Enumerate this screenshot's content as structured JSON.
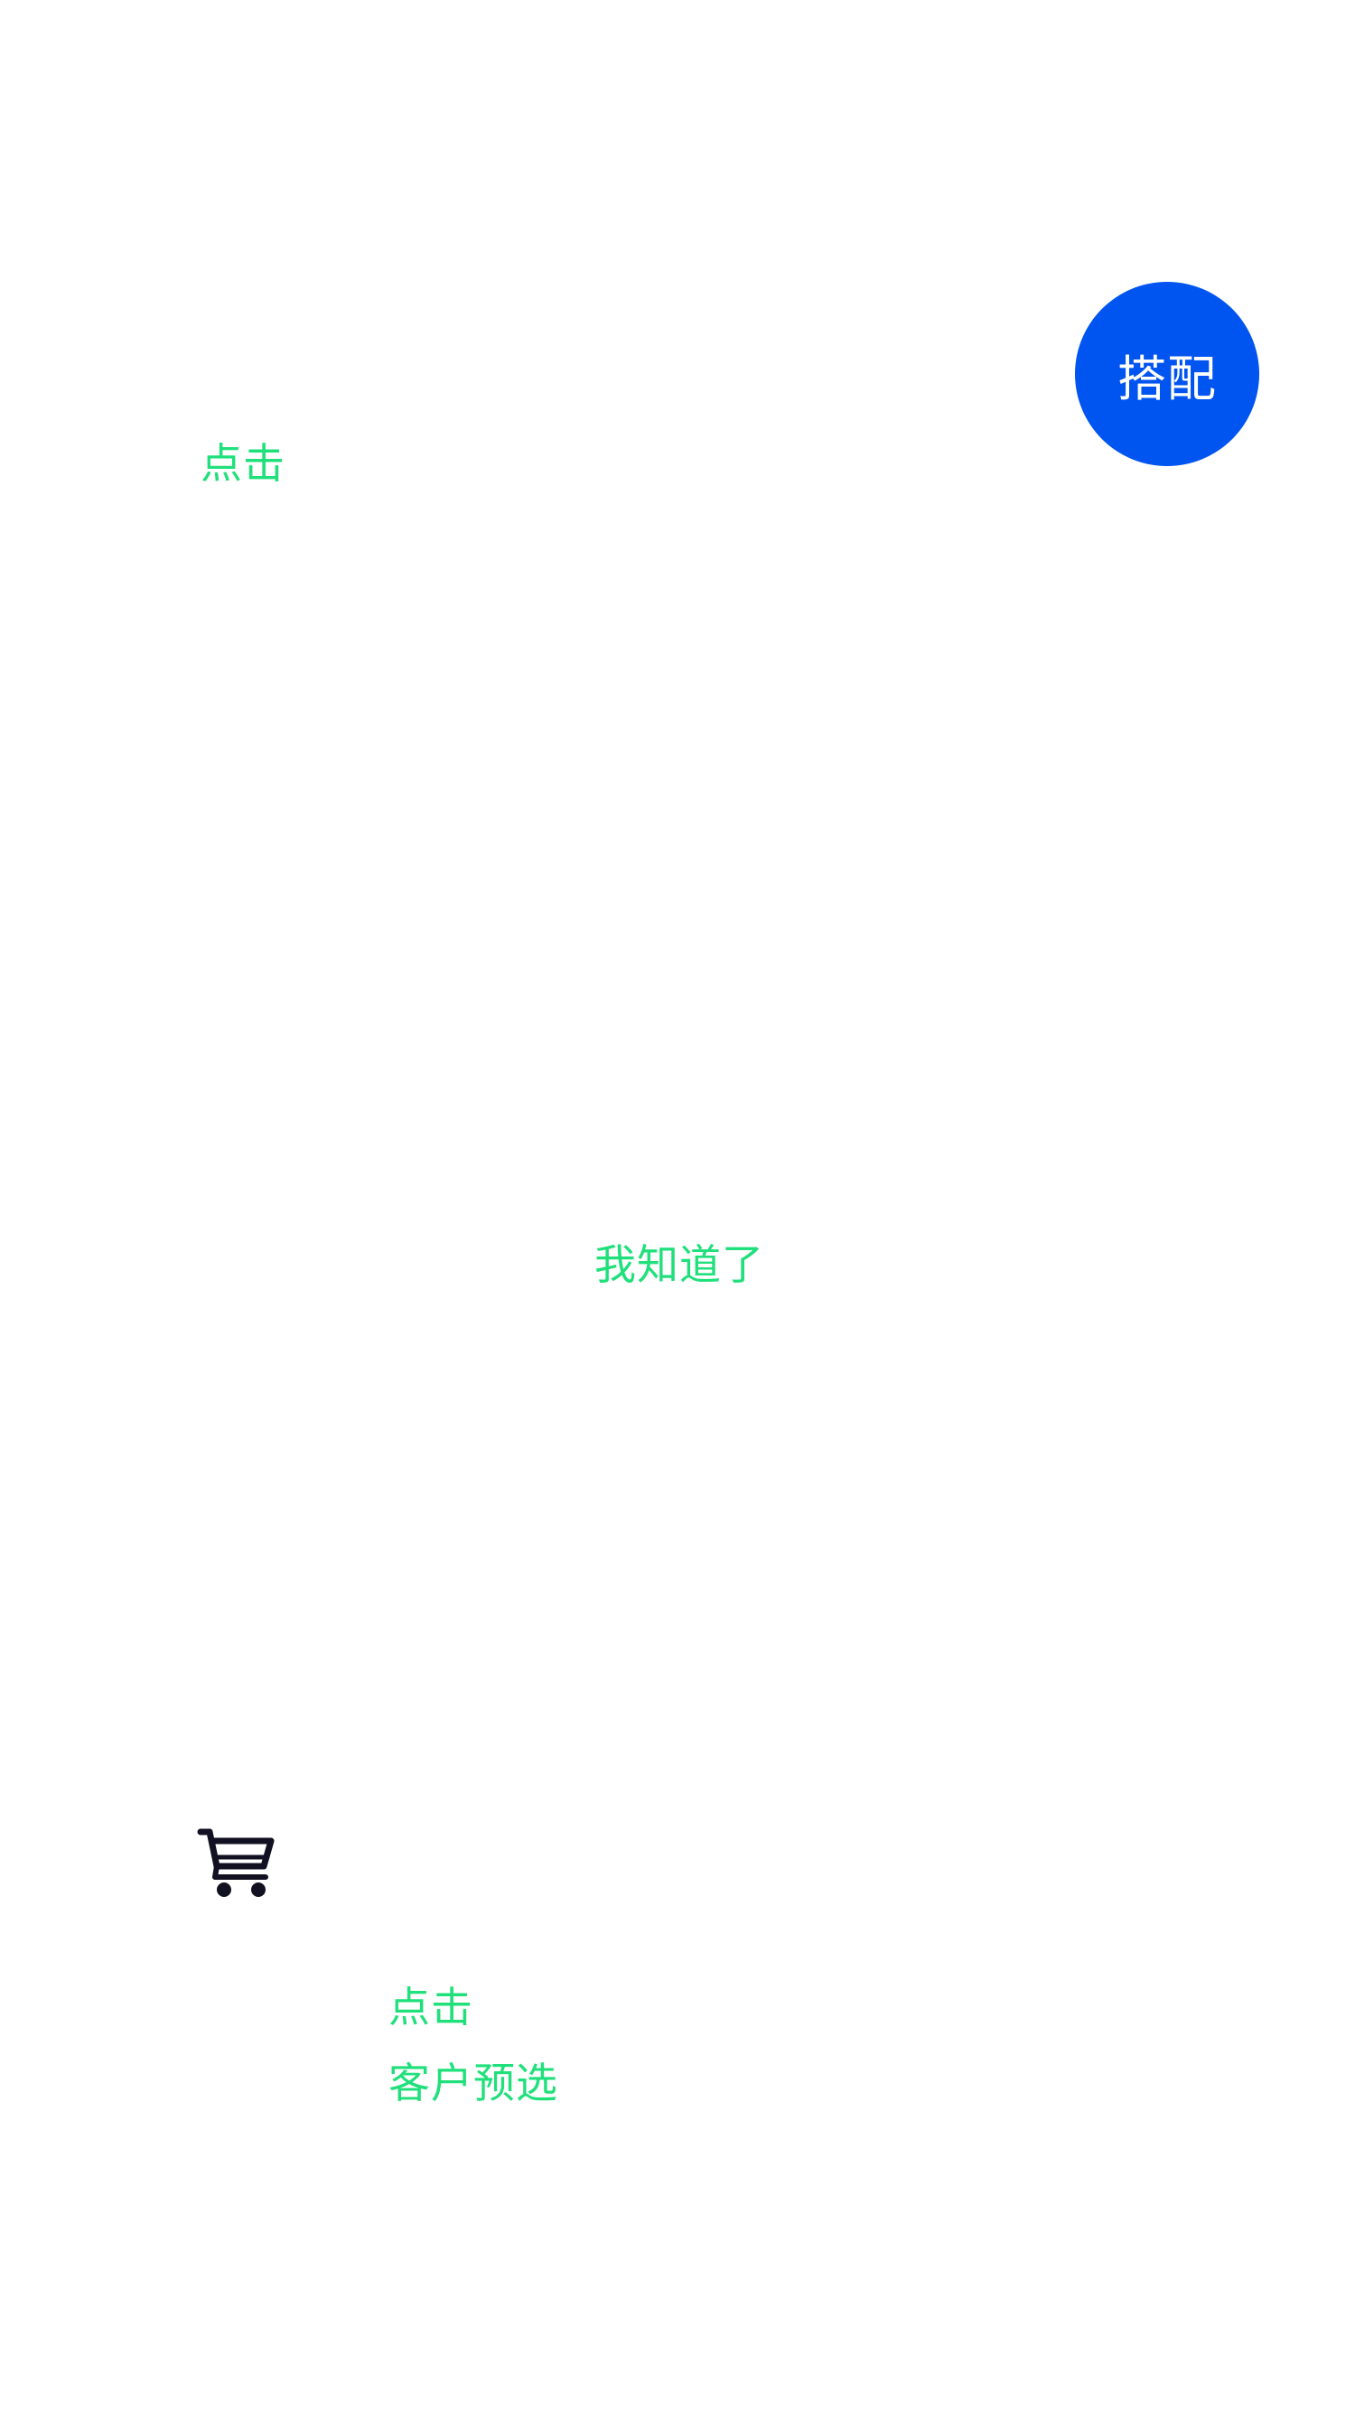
{
  "colors": {
    "hint_text": "#1fe07a",
    "match_button_bg": "#0054f0",
    "cart_icon": "#111122"
  },
  "guide": {
    "top_hint": "点击",
    "got_it_label": "我知道了",
    "bottom_hint_line1": "点击",
    "bottom_hint_line2": "客户预选"
  },
  "match_button": {
    "label": "搭配"
  },
  "icons": {
    "cart": "shopping-cart-icon"
  }
}
